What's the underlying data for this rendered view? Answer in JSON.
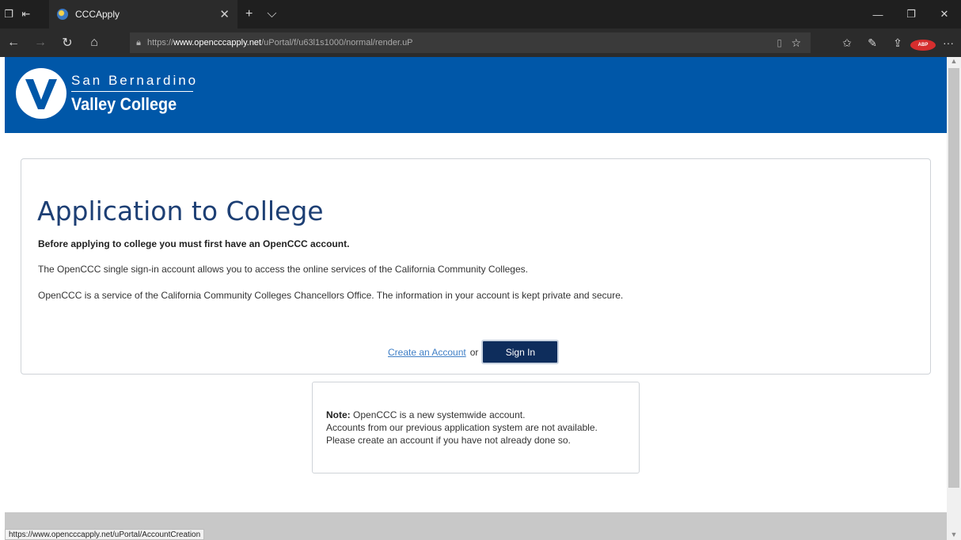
{
  "browser": {
    "tab_title": "CCCApply",
    "url_scheme": "https://",
    "url_host": "www.opencccapply.net",
    "url_path": "/uPortal/f/u63l1s1000/normal/render.uP",
    "status_url": "https://www.opencccapply.net/uPortal/AccountCreation",
    "icons": [
      "tab-actions-icon",
      "set-aside-icon",
      "favicon-icon",
      "close-icon",
      "new-tab-icon",
      "tab-dropdown-icon",
      "minimize-icon",
      "restore-icon",
      "window-close-icon",
      "back-icon",
      "forward-icon",
      "refresh-icon",
      "home-icon",
      "lock-icon",
      "reading-view-icon",
      "favorite-star-icon",
      "favorites-icon",
      "notes-icon",
      "share-icon",
      "adblock-icon",
      "more-icon"
    ],
    "adblock_label": "ABP"
  },
  "header": {
    "logo_line1": "San Bernardino",
    "logo_line2": "Valley College",
    "color": "#0057a8"
  },
  "main": {
    "title": "Application to College",
    "intro_bold": "Before applying to college you must first have an OpenCCC account.",
    "paragraph1": "The OpenCCC single sign-in account allows you to access the online services of the California Community Colleges.",
    "paragraph2": "OpenCCC is a service of the California Community Colleges Chancellors Office. The information in your account is kept private and secure.",
    "create_account_link": "Create an Account",
    "or_text": "or",
    "sign_in_label": "Sign In"
  },
  "note": {
    "label": "Note:",
    "line1": " OpenCCC is a new systemwide account.",
    "line2": "Accounts from our previous application system are not available.",
    "line3": "Please create an account if you have not already done so."
  }
}
